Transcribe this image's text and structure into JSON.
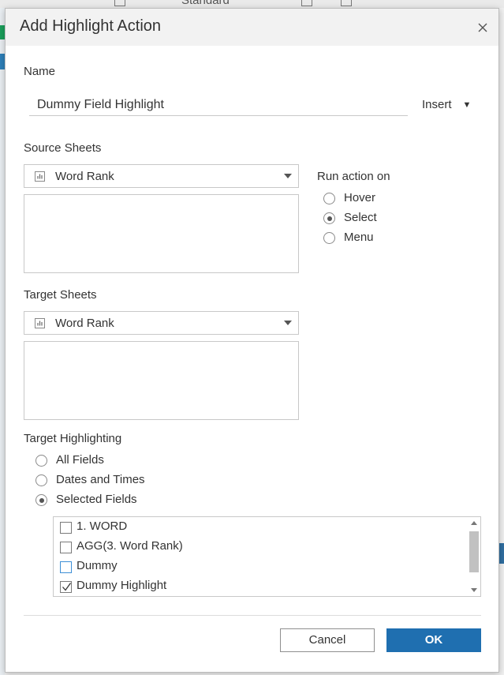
{
  "window": {
    "title": "Add Highlight Action"
  },
  "background": {
    "toolbar_text": "Standard"
  },
  "name_section": {
    "label": "Name",
    "value": "Dummy Field Highlight",
    "insert_label": "Insert"
  },
  "source_sheets": {
    "label": "Source Sheets",
    "selected": "Word Rank"
  },
  "run_action": {
    "label": "Run action on",
    "options": [
      {
        "label": "Hover",
        "checked": false
      },
      {
        "label": "Select",
        "checked": true
      },
      {
        "label": "Menu",
        "checked": false
      }
    ]
  },
  "target_sheets": {
    "label": "Target Sheets",
    "selected": "Word Rank"
  },
  "target_highlighting": {
    "label": "Target Highlighting",
    "options": [
      {
        "label": "All Fields",
        "checked": false
      },
      {
        "label": "Dates and Times",
        "checked": false
      },
      {
        "label": "Selected Fields",
        "checked": true
      }
    ],
    "fields": [
      {
        "label": "1. WORD",
        "checked": false
      },
      {
        "label": "AGG(3. Word Rank)",
        "checked": false
      },
      {
        "label": "Dummy",
        "checked": false,
        "focused": true
      },
      {
        "label": "Dummy Highlight",
        "checked": true
      }
    ]
  },
  "buttons": {
    "cancel": "Cancel",
    "ok": "OK"
  },
  "colors": {
    "primary": "#1f6fb0",
    "title_bar": "#f2f2f2",
    "border": "#c8c8c8"
  },
  "icons": {
    "close": "close-icon",
    "sheet": "bar-chart-sheet-icon",
    "dropdown": "caret-down-icon"
  }
}
